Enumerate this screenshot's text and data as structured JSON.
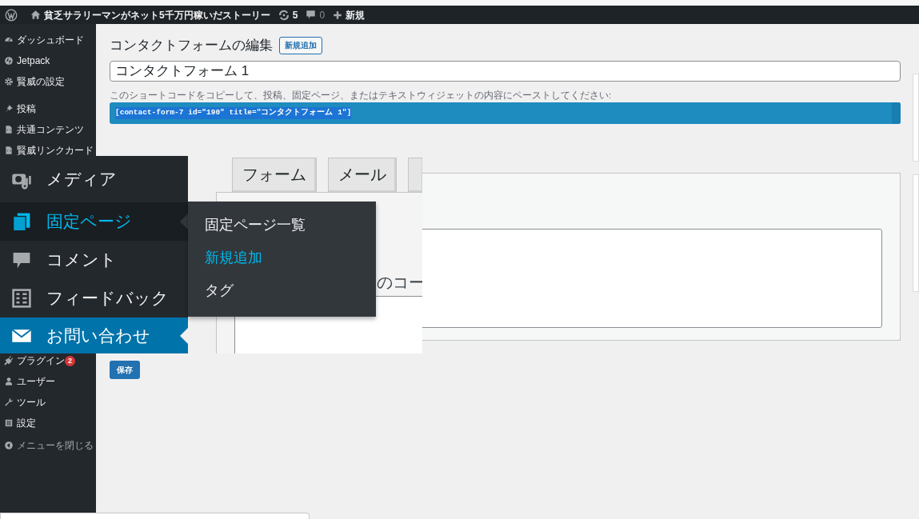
{
  "admin_bar": {
    "site_title": "貧乏サラリーマンがネット5千万円稼いだストーリー",
    "updates": "5",
    "comments": "0",
    "new": "新規"
  },
  "sidebar": {
    "top_items": [
      {
        "label": "ダッシュボード",
        "kind": "dashboard"
      },
      {
        "label": "Jetpack",
        "kind": "jetpack"
      },
      {
        "label": "賢威の設定",
        "kind": "gear"
      },
      {
        "label": "投稿",
        "kind": "pin",
        "separator_before": true
      },
      {
        "label": "共通コンテンツ",
        "kind": "document"
      },
      {
        "label": "賢威リンクカード",
        "kind": "document"
      }
    ],
    "bottom_items": [
      {
        "label": "プラグイン",
        "kind": "plugin",
        "badge": "2"
      },
      {
        "label": "ユーザー",
        "kind": "user"
      },
      {
        "label": "ツール",
        "kind": "wrench"
      },
      {
        "label": "設定",
        "kind": "settings"
      },
      {
        "label": "メニューを閉じる",
        "kind": "collapse"
      }
    ]
  },
  "page": {
    "heading": "コンタクトフォームの編集",
    "add_new_button": "新規追加",
    "title_value": "コンタクトフォーム 1",
    "hint": "このショートコードをコピーして、投稿、固定ページ、またはテキストウィジェットの内容にペーストしてください:",
    "shortcode": "[contact-form-7 id=\"190\" title=\"コンタクトフォーム 1\"]",
    "save_button": "保存"
  },
  "zoom_inset": {
    "menu_items": [
      {
        "label": "メディア",
        "kind": "media",
        "selected": false,
        "hovered": false
      },
      {
        "label": "固定ページ",
        "kind": "pages",
        "selected": false,
        "hovered": true
      },
      {
        "label": "コメント",
        "kind": "comment",
        "selected": false,
        "hovered": false
      },
      {
        "label": "フィードバック",
        "kind": "feedback",
        "selected": false,
        "hovered": false
      },
      {
        "label": "お問い合わせ",
        "kind": "mail",
        "selected": true,
        "hovered": false
      }
    ],
    "flyout_items": [
      {
        "label": "固定ページ一覧",
        "selected": false
      },
      {
        "label": "新規追加",
        "selected": true
      },
      {
        "label": "タグ",
        "selected": false
      }
    ],
    "tabs": [
      "フォーム",
      "メール"
    ],
    "partial_text": "のコー"
  }
}
